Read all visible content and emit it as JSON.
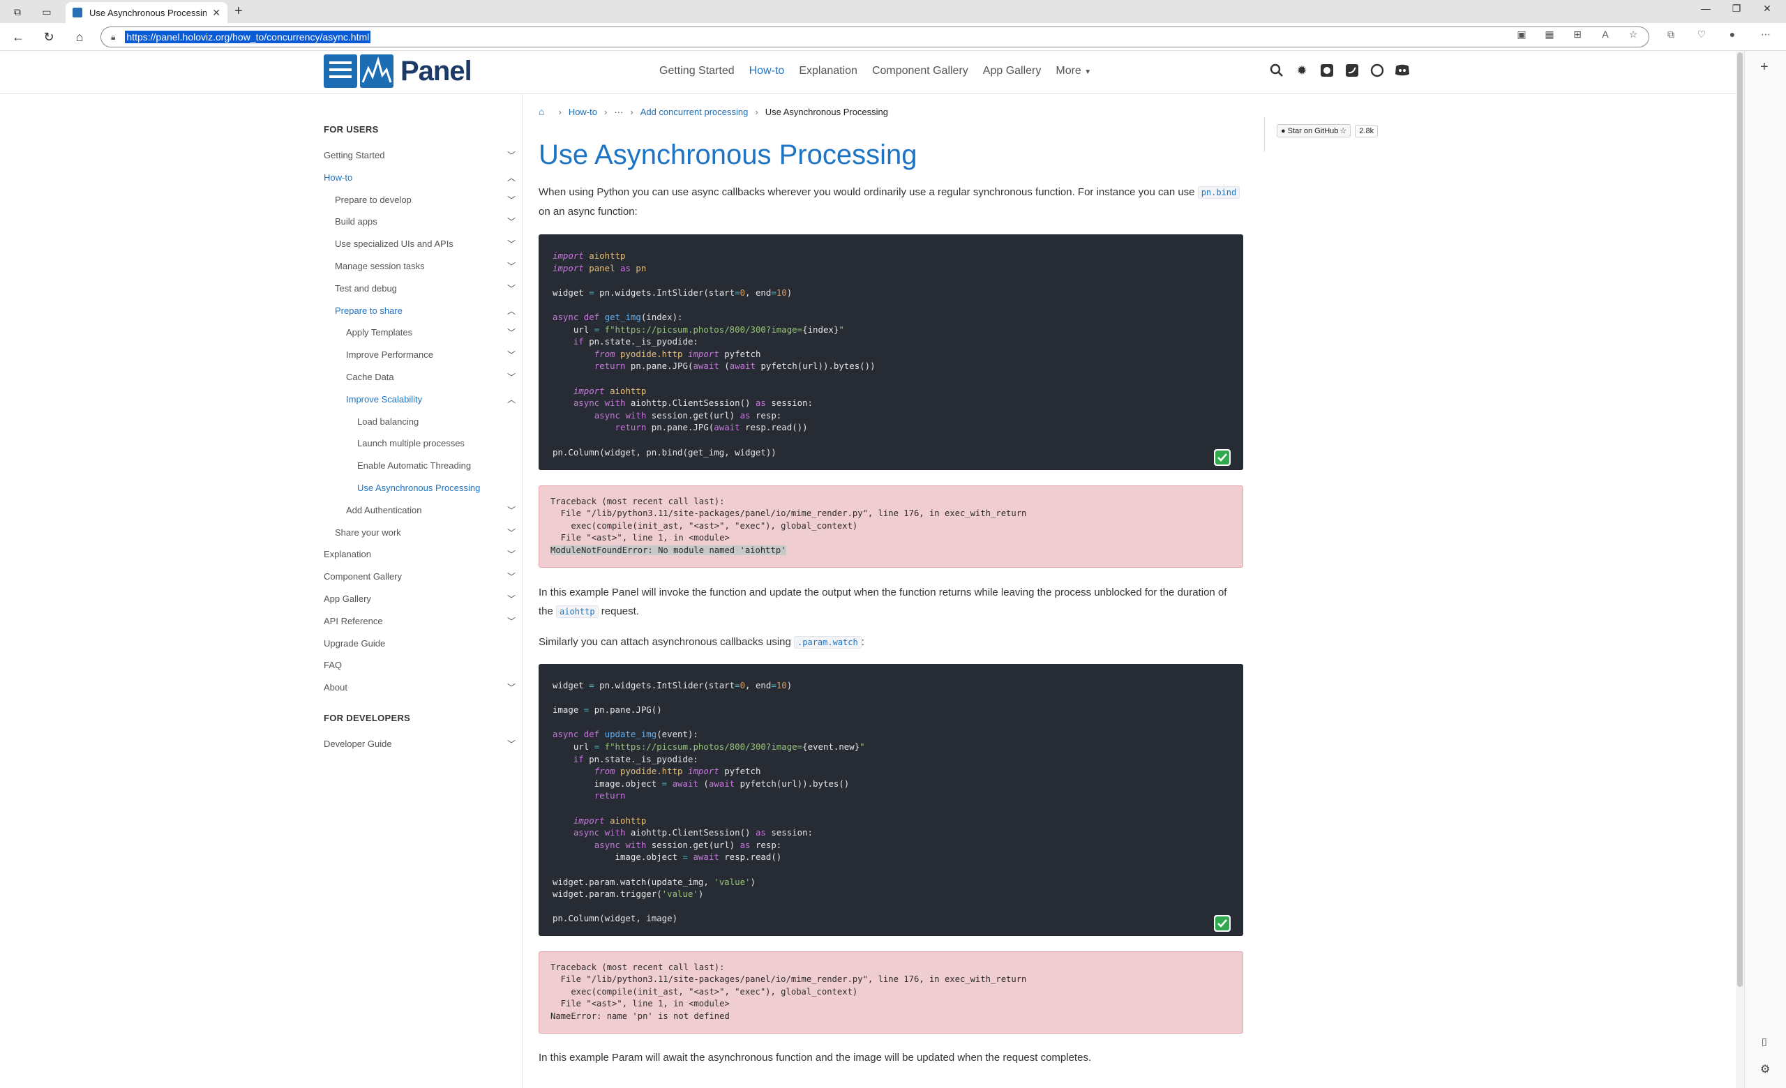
{
  "browser": {
    "tab_title": "Use Asynchronous Processing —",
    "url": "https://panel.holoviz.org/how_to/concurrency/async.html"
  },
  "site": {
    "logo_text": "Panel",
    "nav": [
      "Getting Started",
      "How-to",
      "Explanation",
      "Component Gallery",
      "App Gallery",
      "More"
    ]
  },
  "sidebar": {
    "users_title": "FOR USERS",
    "developers_title": "FOR DEVELOPERS",
    "items": [
      {
        "label": "Getting Started",
        "level": 0,
        "chev": "down"
      },
      {
        "label": "How-to",
        "level": 0,
        "chev": "up",
        "active": true
      },
      {
        "label": "Prepare to develop",
        "level": 1,
        "chev": "down"
      },
      {
        "label": "Build apps",
        "level": 1,
        "chev": "down"
      },
      {
        "label": "Use specialized UIs and APIs",
        "level": 1,
        "chev": "down"
      },
      {
        "label": "Manage session tasks",
        "level": 1,
        "chev": "down"
      },
      {
        "label": "Test and debug",
        "level": 1,
        "chev": "down"
      },
      {
        "label": "Prepare to share",
        "level": 1,
        "chev": "up",
        "active": true
      },
      {
        "label": "Apply Templates",
        "level": 2,
        "chev": "down"
      },
      {
        "label": "Improve Performance",
        "level": 2,
        "chev": "down"
      },
      {
        "label": "Cache Data",
        "level": 2,
        "chev": "down"
      },
      {
        "label": "Improve Scalability",
        "level": 2,
        "chev": "up",
        "active": true
      },
      {
        "label": "Load balancing",
        "level": 3
      },
      {
        "label": "Launch multiple processes",
        "level": 3
      },
      {
        "label": "Enable Automatic Threading",
        "level": 3
      },
      {
        "label": "Use Asynchronous Processing",
        "level": 3,
        "active": true
      },
      {
        "label": "Add Authentication",
        "level": 2,
        "chev": "down"
      },
      {
        "label": "Share your work",
        "level": 1,
        "chev": "down"
      },
      {
        "label": "Explanation",
        "level": 0,
        "chev": "down"
      },
      {
        "label": "Component Gallery",
        "level": 0,
        "chev": "down"
      },
      {
        "label": "App Gallery",
        "level": 0,
        "chev": "down"
      },
      {
        "label": "API Reference",
        "level": 0,
        "chev": "down"
      },
      {
        "label": "Upgrade Guide",
        "level": 0
      },
      {
        "label": "FAQ",
        "level": 0
      },
      {
        "label": "About",
        "level": 0,
        "chev": "down"
      }
    ],
    "dev_items": [
      {
        "label": "Developer Guide",
        "level": 0,
        "chev": "down"
      }
    ]
  },
  "breadcrumb": {
    "crumbs": [
      "How-to",
      "···",
      "Add concurrent processing"
    ],
    "current": "Use Asynchronous Processing"
  },
  "page": {
    "title": "Use Asynchronous Processing",
    "p1_a": "When using Python you can use async callbacks wherever you would ordinarily use a regular synchronous function. For instance you can use ",
    "p1_code": "pn.bind",
    "p1_b": " on an async function:",
    "p2_a": "In this example Panel will invoke the function and update the output when the function returns while leaving the process unblocked for the duration of the ",
    "p2_code": "aiohttp",
    "p2_b": " request.",
    "p3_a": "Similarly you can attach asynchronous callbacks using ",
    "p3_code": ".param.watch",
    "p3_b": ":",
    "p4": "In this example Param will await the asynchronous function and the image will be updated when the request completes.",
    "error1": [
      "Traceback (most recent call last):",
      "  File \"/lib/python3.11/site-packages/panel/io/mime_render.py\", line 176, in exec_with_return",
      "    exec(compile(init_ast, \"<ast>\", \"exec\"), global_context)",
      "  File \"<ast>\", line 1, in <module>",
      "ModuleNotFoundError: No module named 'aiohttp'"
    ],
    "error2": [
      "Traceback (most recent call last):",
      "  File \"/lib/python3.11/site-packages/panel/io/mime_render.py\", line 176, in exec_with_return",
      "    exec(compile(init_ast, \"<ast>\", \"exec\"), global_context)",
      "  File \"<ast>\", line 1, in <module>",
      "NameError: name 'pn' is not defined"
    ]
  },
  "github": {
    "label": "Star on GitHub",
    "count": "2.8k"
  },
  "colors": {
    "accent": "#1d73c4",
    "code_bg": "#272b33",
    "error_bg": "#f0cdd0"
  }
}
